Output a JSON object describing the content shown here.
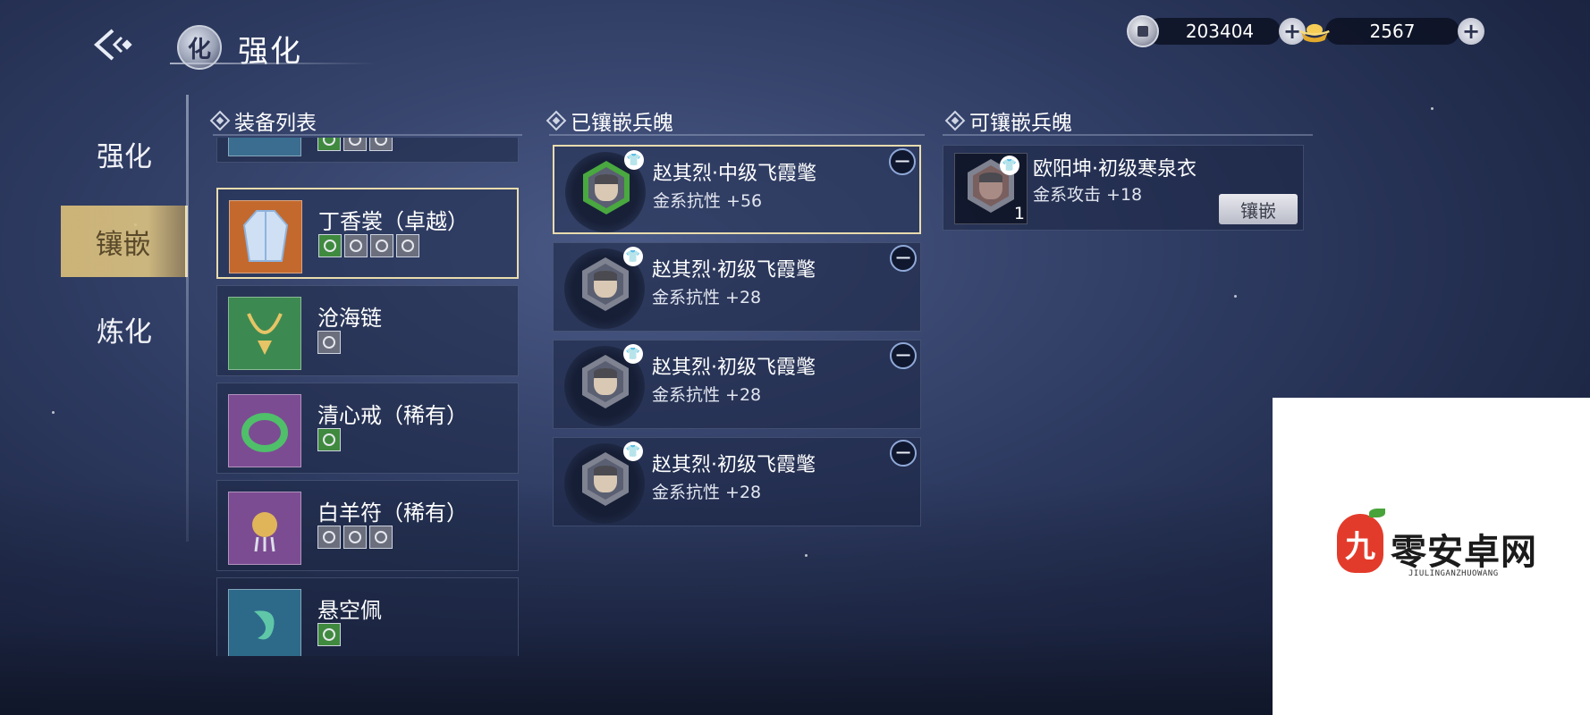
{
  "header": {
    "title": "强化",
    "emblem_glyph": "化"
  },
  "currency": {
    "coins": "203404",
    "ingots": "2567",
    "plus": "+"
  },
  "tabs": [
    {
      "label": "强化",
      "active": false
    },
    {
      "label": "镶嵌",
      "active": true
    },
    {
      "label": "炼化",
      "active": false
    }
  ],
  "sections": {
    "equipment_list": "装备列表",
    "embedded": "已镶嵌兵魄",
    "available": "可镶嵌兵魄"
  },
  "equipment": [
    {
      "name": "丁香裳（卓越）",
      "selected": true,
      "gems": [
        "green",
        "grey",
        "grey",
        "grey"
      ],
      "thumb_color": "#c3692e"
    },
    {
      "name": "沧海链",
      "selected": false,
      "gems": [
        "grey"
      ],
      "thumb_color": "#3c8a52"
    },
    {
      "name": "清心戒（稀有）",
      "selected": false,
      "gems": [
        "green"
      ],
      "thumb_color": "#7c4c93"
    },
    {
      "name": "白羊符（稀有）",
      "selected": false,
      "gems": [
        "grey",
        "grey",
        "grey"
      ],
      "thumb_color": "#7c4c93"
    },
    {
      "name": "悬空佩",
      "selected": false,
      "gems": [
        "green"
      ],
      "thumb_color": "#2d6a8a"
    }
  ],
  "embedded_souls": [
    {
      "name": "赵其烈·中级飞霞氅",
      "stat": "金系抗性 +56",
      "tier": "green",
      "selected": true
    },
    {
      "name": "赵其烈·初级飞霞氅",
      "stat": "金系抗性 +28",
      "tier": "grey",
      "selected": false
    },
    {
      "name": "赵其烈·初级飞霞氅",
      "stat": "金系抗性 +28",
      "tier": "grey",
      "selected": false
    },
    {
      "name": "赵其烈·初级飞霞氅",
      "stat": "金系抗性 +28",
      "tier": "grey",
      "selected": false
    }
  ],
  "minus_symbol": "−",
  "available_souls": [
    {
      "name": "欧阳坤·初级寒泉衣",
      "stat": "金系攻击 +18",
      "count": "1",
      "button": "镶嵌"
    }
  ],
  "watermark": {
    "logo_glyph": "九",
    "text": "零安卓网",
    "sub": "JIULINGANZHUOWANG"
  }
}
